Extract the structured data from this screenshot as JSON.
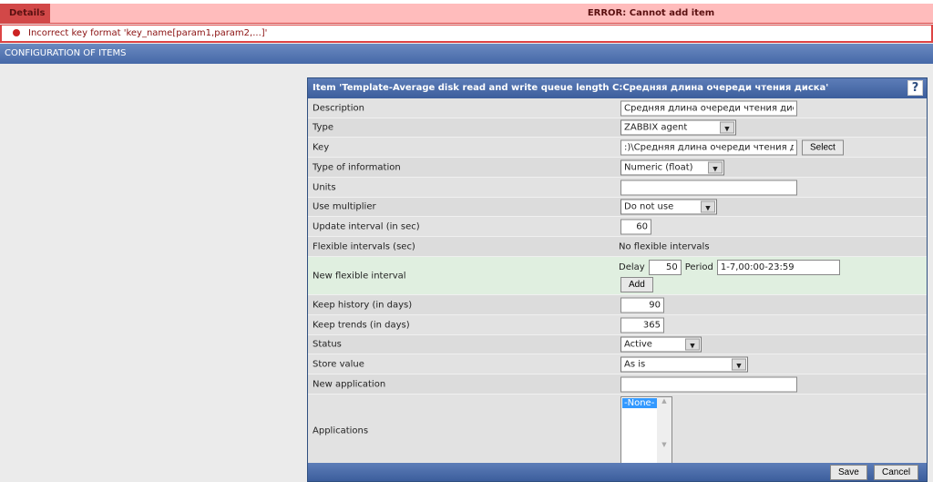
{
  "error": {
    "tab": "Details",
    "title": "ERROR: Cannot add item",
    "message": "Incorrect key format 'key_name[param1,param2,...]'"
  },
  "section_title": "CONFIGURATION OF ITEMS",
  "form": {
    "title": "Item 'Template-Average disk read and write queue length C:Средняя длина очереди чтения диска'",
    "help": "?",
    "labels": {
      "description": "Description",
      "type": "Type",
      "key": "Key",
      "type_info": "Type of information",
      "units": "Units",
      "multiplier": "Use multiplier",
      "interval": "Update interval (in sec)",
      "flex": "Flexible intervals (sec)",
      "new_flex": "New flexible interval",
      "history": "Keep history (in days)",
      "trends": "Keep trends (in days)",
      "status": "Status",
      "store": "Store value",
      "new_app": "New application",
      "apps": "Applications"
    },
    "values": {
      "description": "Средняя длина очереди чтения диска",
      "type": "ZABBIX agent",
      "key": ":)\\Средняя длина очереди чтения диска]",
      "type_info": "Numeric (float)",
      "units": "",
      "multiplier": "Do not use",
      "interval": "60",
      "flex": "No flexible intervals",
      "delay_label": "Delay",
      "delay": "50",
      "period_label": "Period",
      "period": "1-7,00:00-23:59",
      "history": "90",
      "trends": "365",
      "status": "Active",
      "store": "As is",
      "new_app": "",
      "app_option": "-None-"
    },
    "buttons": {
      "select": "Select",
      "add": "Add",
      "save": "Save",
      "cancel": "Cancel"
    }
  }
}
